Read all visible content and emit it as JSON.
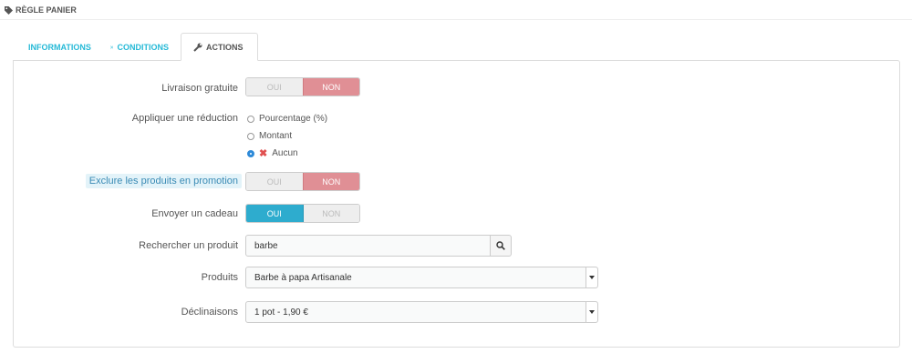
{
  "header": {
    "title": "RÈGLE PANIER",
    "icon": "tag-icon"
  },
  "tabs": [
    {
      "label": "INFORMATIONS",
      "icon": "info-icon",
      "active": false
    },
    {
      "label": "CONDITIONS",
      "icon": "shuffle-icon",
      "active": false
    },
    {
      "label": "ACTIONS",
      "icon": "wrench-icon",
      "active": true
    }
  ],
  "form": {
    "free_shipping": {
      "label": "Livraison gratuite",
      "yes": "OUI",
      "no": "NON",
      "value": "NON"
    },
    "discount": {
      "label": "Appliquer une réduction",
      "options": [
        {
          "label": "Pourcentage (%)",
          "checked": false
        },
        {
          "label": "Montant",
          "checked": false
        },
        {
          "label": "Aucun",
          "checked": true,
          "icon": "x-icon"
        }
      ]
    },
    "exclude_promo": {
      "label": "Exclure les produits en promotion",
      "yes": "OUI",
      "no": "NON",
      "value": "NON"
    },
    "gift": {
      "label": "Envoyer un cadeau",
      "yes": "OUI",
      "no": "NON",
      "value": "OUI"
    },
    "search": {
      "label": "Rechercher un produit",
      "value": "barbe",
      "icon": "search-icon"
    },
    "products": {
      "label": "Produits",
      "selected": "Barbe à papa Artisanale"
    },
    "variants": {
      "label": "Déclinaisons",
      "selected": "1 pot - 1,90 €"
    }
  },
  "colors": {
    "accent": "#25b9d7",
    "no_active": "#e08f95",
    "yes_active": "#2eacce"
  }
}
